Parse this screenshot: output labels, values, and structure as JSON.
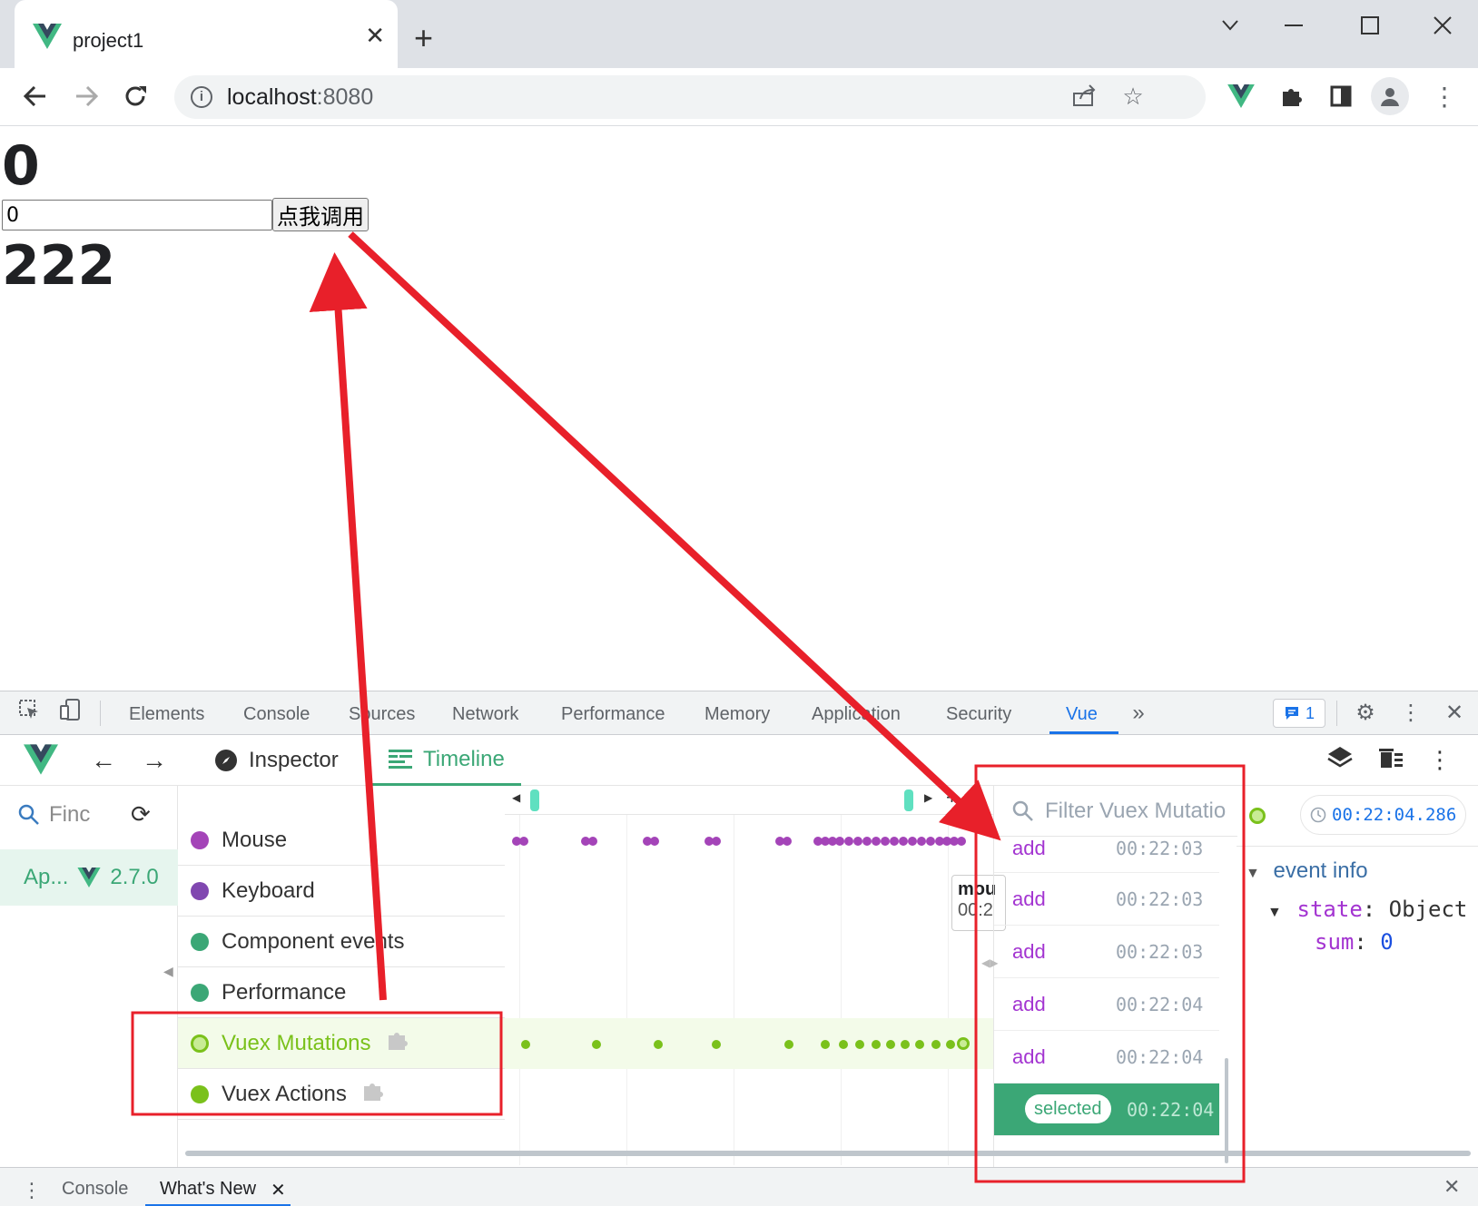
{
  "browser": {
    "tab_title": "project1",
    "url_host": "localhost",
    "url_port": ":8080"
  },
  "page": {
    "count_value": "0",
    "input_value": "0",
    "call_button_label": "点我调用",
    "result_value": "222"
  },
  "devtools": {
    "tabs": [
      "Elements",
      "Console",
      "Sources",
      "Network",
      "Performance",
      "Memory",
      "Application",
      "Security",
      "Vue"
    ],
    "active_tab": "Vue",
    "issues_count": "1"
  },
  "vue": {
    "tabs": {
      "inspector": "Inspector",
      "timeline": "Timeline"
    },
    "app_search_placeholder": "Finc",
    "app": {
      "name": "Ap...",
      "version": "2.7.0"
    },
    "layers": [
      {
        "label": "Mouse",
        "color": "#a444b8"
      },
      {
        "label": "Keyboard",
        "color": "#8047b0"
      },
      {
        "label": "Component events",
        "color": "#3ba776"
      },
      {
        "label": "Performance",
        "color": "#3ba776"
      },
      {
        "label": "Vuex Mutations",
        "color": "#7ac11b"
      },
      {
        "label": "Vuex Actions",
        "color": "#7ac11b"
      }
    ],
    "tooltip": {
      "title": "mou",
      "time": "00:2"
    },
    "filter_placeholder": "Filter Vuex Mutatio",
    "events": [
      {
        "name": "add",
        "time": "00:22:03"
      },
      {
        "name": "add",
        "time": "00:22:03"
      },
      {
        "name": "add",
        "time": "00:22:03"
      },
      {
        "name": "add",
        "time": "00:22:04"
      },
      {
        "name": "add",
        "time": "00:22:04"
      }
    ],
    "selected_event": {
      "label": "selected",
      "time": "00:22:04"
    },
    "detail": {
      "timestamp": "00:22:04.286",
      "section": "event info",
      "state_key": "state",
      "state_value": "Object",
      "sum_key": "sum",
      "sum_value": "0"
    }
  },
  "drawer": {
    "tabs": [
      "Console",
      "What's New"
    ]
  },
  "colors": {
    "vue_green": "#3ba776",
    "vuex_green": "#7ac11b",
    "mouse_purple": "#a444b8",
    "annotation_red": "#e8202a",
    "devtools_blue": "#1a73e8"
  }
}
